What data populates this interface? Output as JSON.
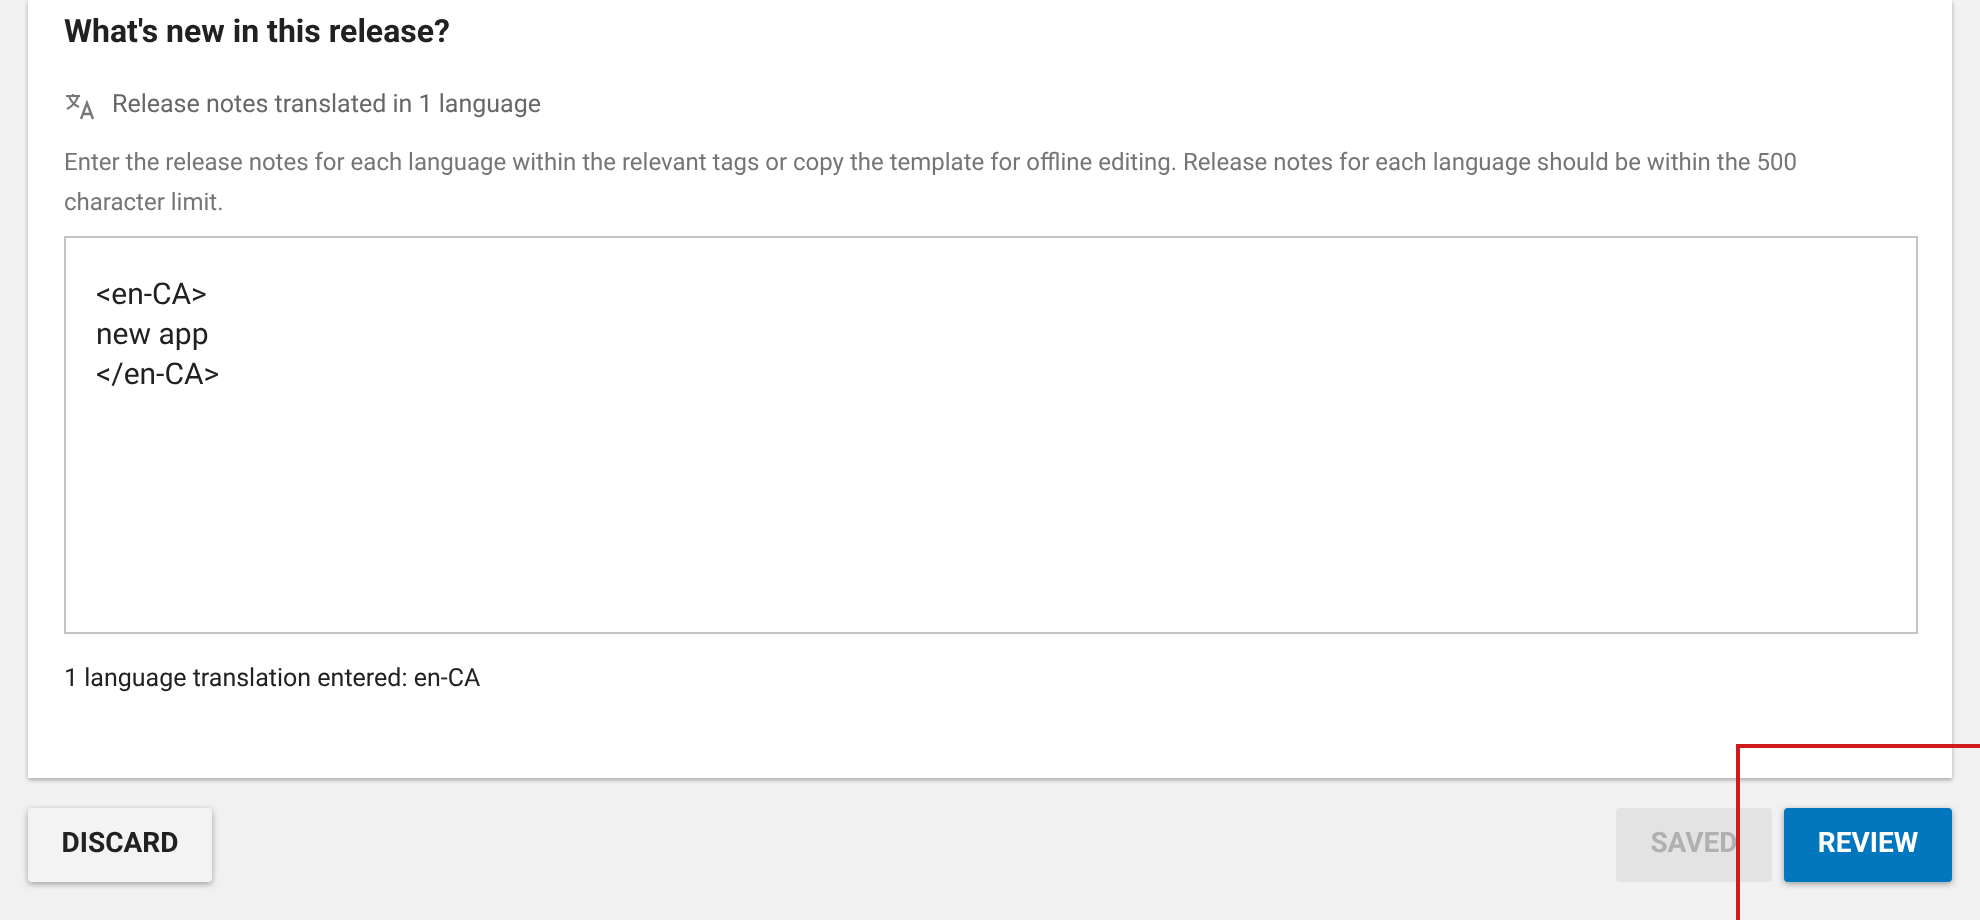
{
  "section": {
    "title": "What's new in this release?",
    "translation_status": "Release notes translated in 1 language",
    "instructions": "Enter the release notes for each language within the relevant tags or copy the template for offline editing. Release notes for each language should be within the 500 character limit.",
    "notes_value": "<en-CA>\nnew app\n</en-CA>",
    "entered_summary": "1 language translation entered: en-CA"
  },
  "buttons": [
    {
      "label": "DISCARD",
      "kind": "outlined",
      "disabled": false
    },
    {
      "label": "SAVED",
      "kind": "text",
      "disabled": true
    },
    {
      "label": "REVIEW",
      "kind": "primary",
      "disabled": false
    }
  ],
  "annotation": {
    "kind": "highlight"
  }
}
